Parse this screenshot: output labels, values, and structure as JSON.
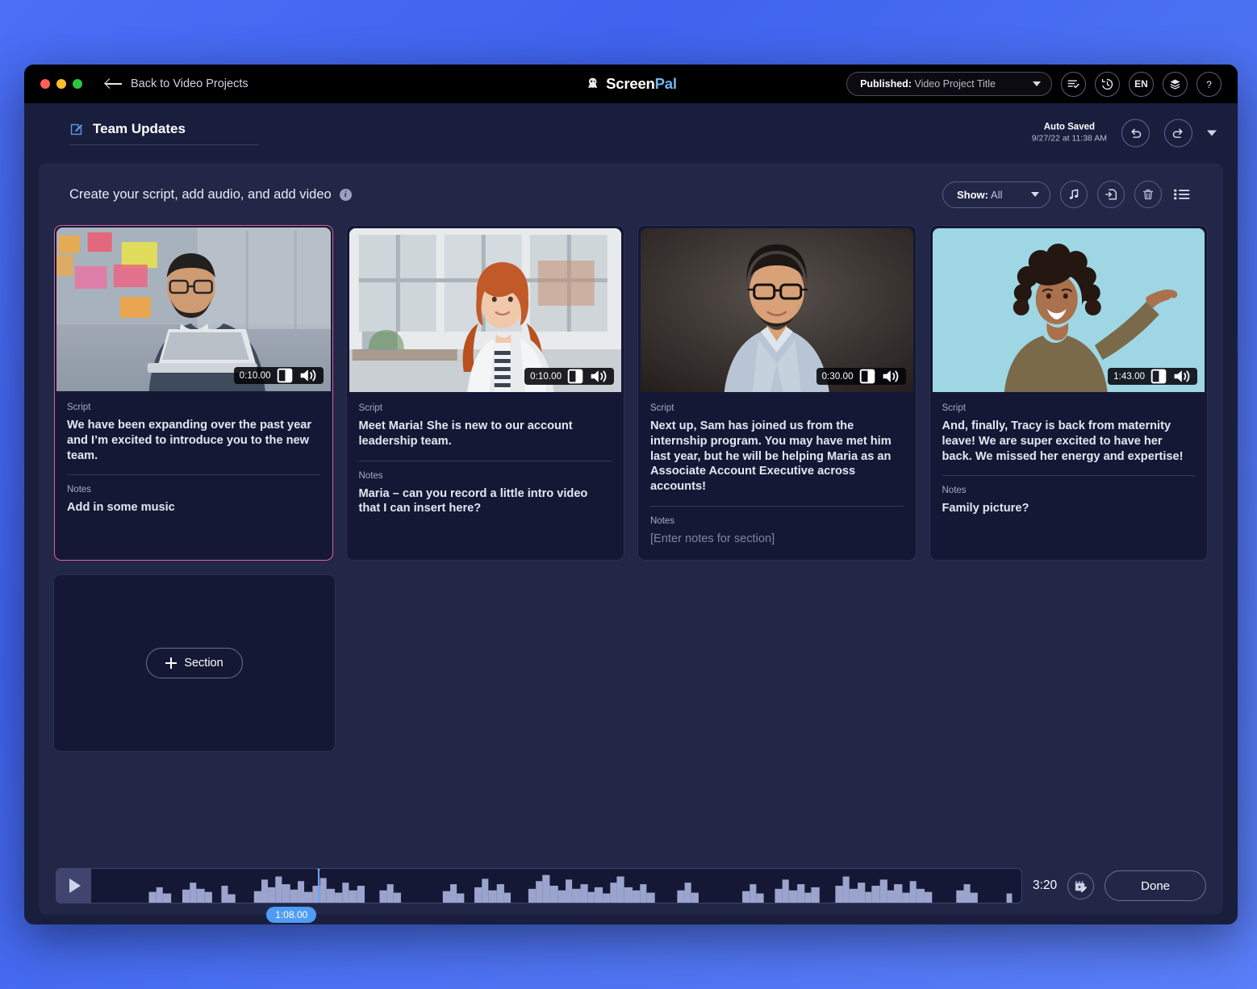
{
  "titlebar": {
    "back_label": "Back to Video Projects",
    "brand_white": "Screen",
    "brand_blue": "Pal",
    "publish_prefix": "Published:",
    "publish_value": "Video Project Title",
    "lang": "EN",
    "icons": [
      "checklist-icon",
      "history-icon",
      "language-icon",
      "layers-icon",
      "help-icon"
    ]
  },
  "project": {
    "title": "Team Updates",
    "autosave_label": "Auto Saved",
    "autosave_time": "9/27/22 at 11:38 AM"
  },
  "panel": {
    "heading": "Create your script, add audio, and add video",
    "show_prefix": "Show:",
    "show_value": "All"
  },
  "cards": [
    {
      "duration": "0:10.00",
      "script_label": "Script",
      "script": "We have been expanding over the past year and I’m excited to introduce you to the new team.",
      "notes_label": "Notes",
      "notes": "Add in some music",
      "notes_is_placeholder": false,
      "selected": true,
      "thumb": "man-at-laptop-office"
    },
    {
      "duration": "0:10.00",
      "script_label": "Script",
      "script": "Meet Maria! She is new to our account leadership team.",
      "notes_label": "Notes",
      "notes": "Maria – can you record a little intro video that I can insert here?",
      "notes_is_placeholder": false,
      "selected": false,
      "thumb": "woman-redhead-office"
    },
    {
      "duration": "0:30.00",
      "script_label": "Script",
      "script": "Next up, Sam has joined us from the internship program. You may have met him last year, but he will be helping Maria as an Associate Account Executive across accounts!",
      "notes_label": "Notes",
      "notes": "[Enter notes for section]",
      "notes_is_placeholder": true,
      "selected": false,
      "thumb": "man-glasses-dark-bg"
    },
    {
      "duration": "1:43.00",
      "script_label": "Script",
      "script": "And, finally, Tracy is back from maternity leave! We are super excited to have her back. We missed her energy and expertise!",
      "notes_label": "Notes",
      "notes": "Family picture?",
      "notes_is_placeholder": false,
      "selected": false,
      "thumb": "woman-selfie-teal-bg"
    }
  ],
  "add_section": {
    "label": "Section"
  },
  "timeline": {
    "playhead_time": "1:08.00",
    "total_time": "3:20",
    "done_label": "Done"
  },
  "colors": {
    "selected_border": "#e0639a",
    "accent_blue": "#4f9cf5",
    "panel_bg": "#222747",
    "card_bg": "#141834",
    "window_bg": "#1a1e3d"
  }
}
